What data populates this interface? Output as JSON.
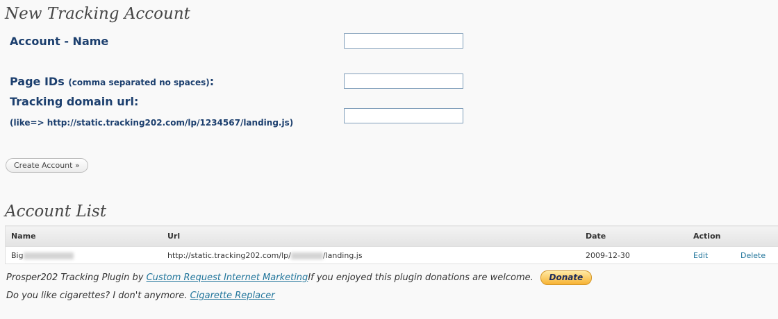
{
  "form": {
    "title": "New Tracking Account",
    "account_name_label": "Account - Name",
    "page_ids_label": "Page IDs",
    "page_ids_note": "(comma separated no spaces)",
    "page_ids_colon": ":",
    "tracking_url_label": "Tracking domain url:",
    "tracking_url_hint": "(like=> http://static.tracking202.com/lp/1234567/landing.js)",
    "account_name_value": "",
    "page_ids_value": "",
    "tracking_url_value": "",
    "create_button": "Create Account »"
  },
  "list": {
    "title": "Account List",
    "columns": [
      "Name",
      "Url",
      "Date",
      "Action"
    ],
    "rows": [
      {
        "name_prefix": "Big",
        "url_prefix": "http://static.tracking202.com/lp/",
        "url_suffix": "/landing.js",
        "date": "2009-12-30",
        "edit": "Edit",
        "delete": "Delete"
      }
    ]
  },
  "footer": {
    "credit_prefix": "Prosper202 Tracking Plugin by ",
    "credit_link": "Custom Request Internet Marketing",
    "donation_text": "If you enjoyed this plugin donations are welcome.",
    "donate_button": "Donate",
    "cig_text": "Do you like cigarettes? I don't anymore. ",
    "cig_link": "Cigarette Replacer"
  }
}
